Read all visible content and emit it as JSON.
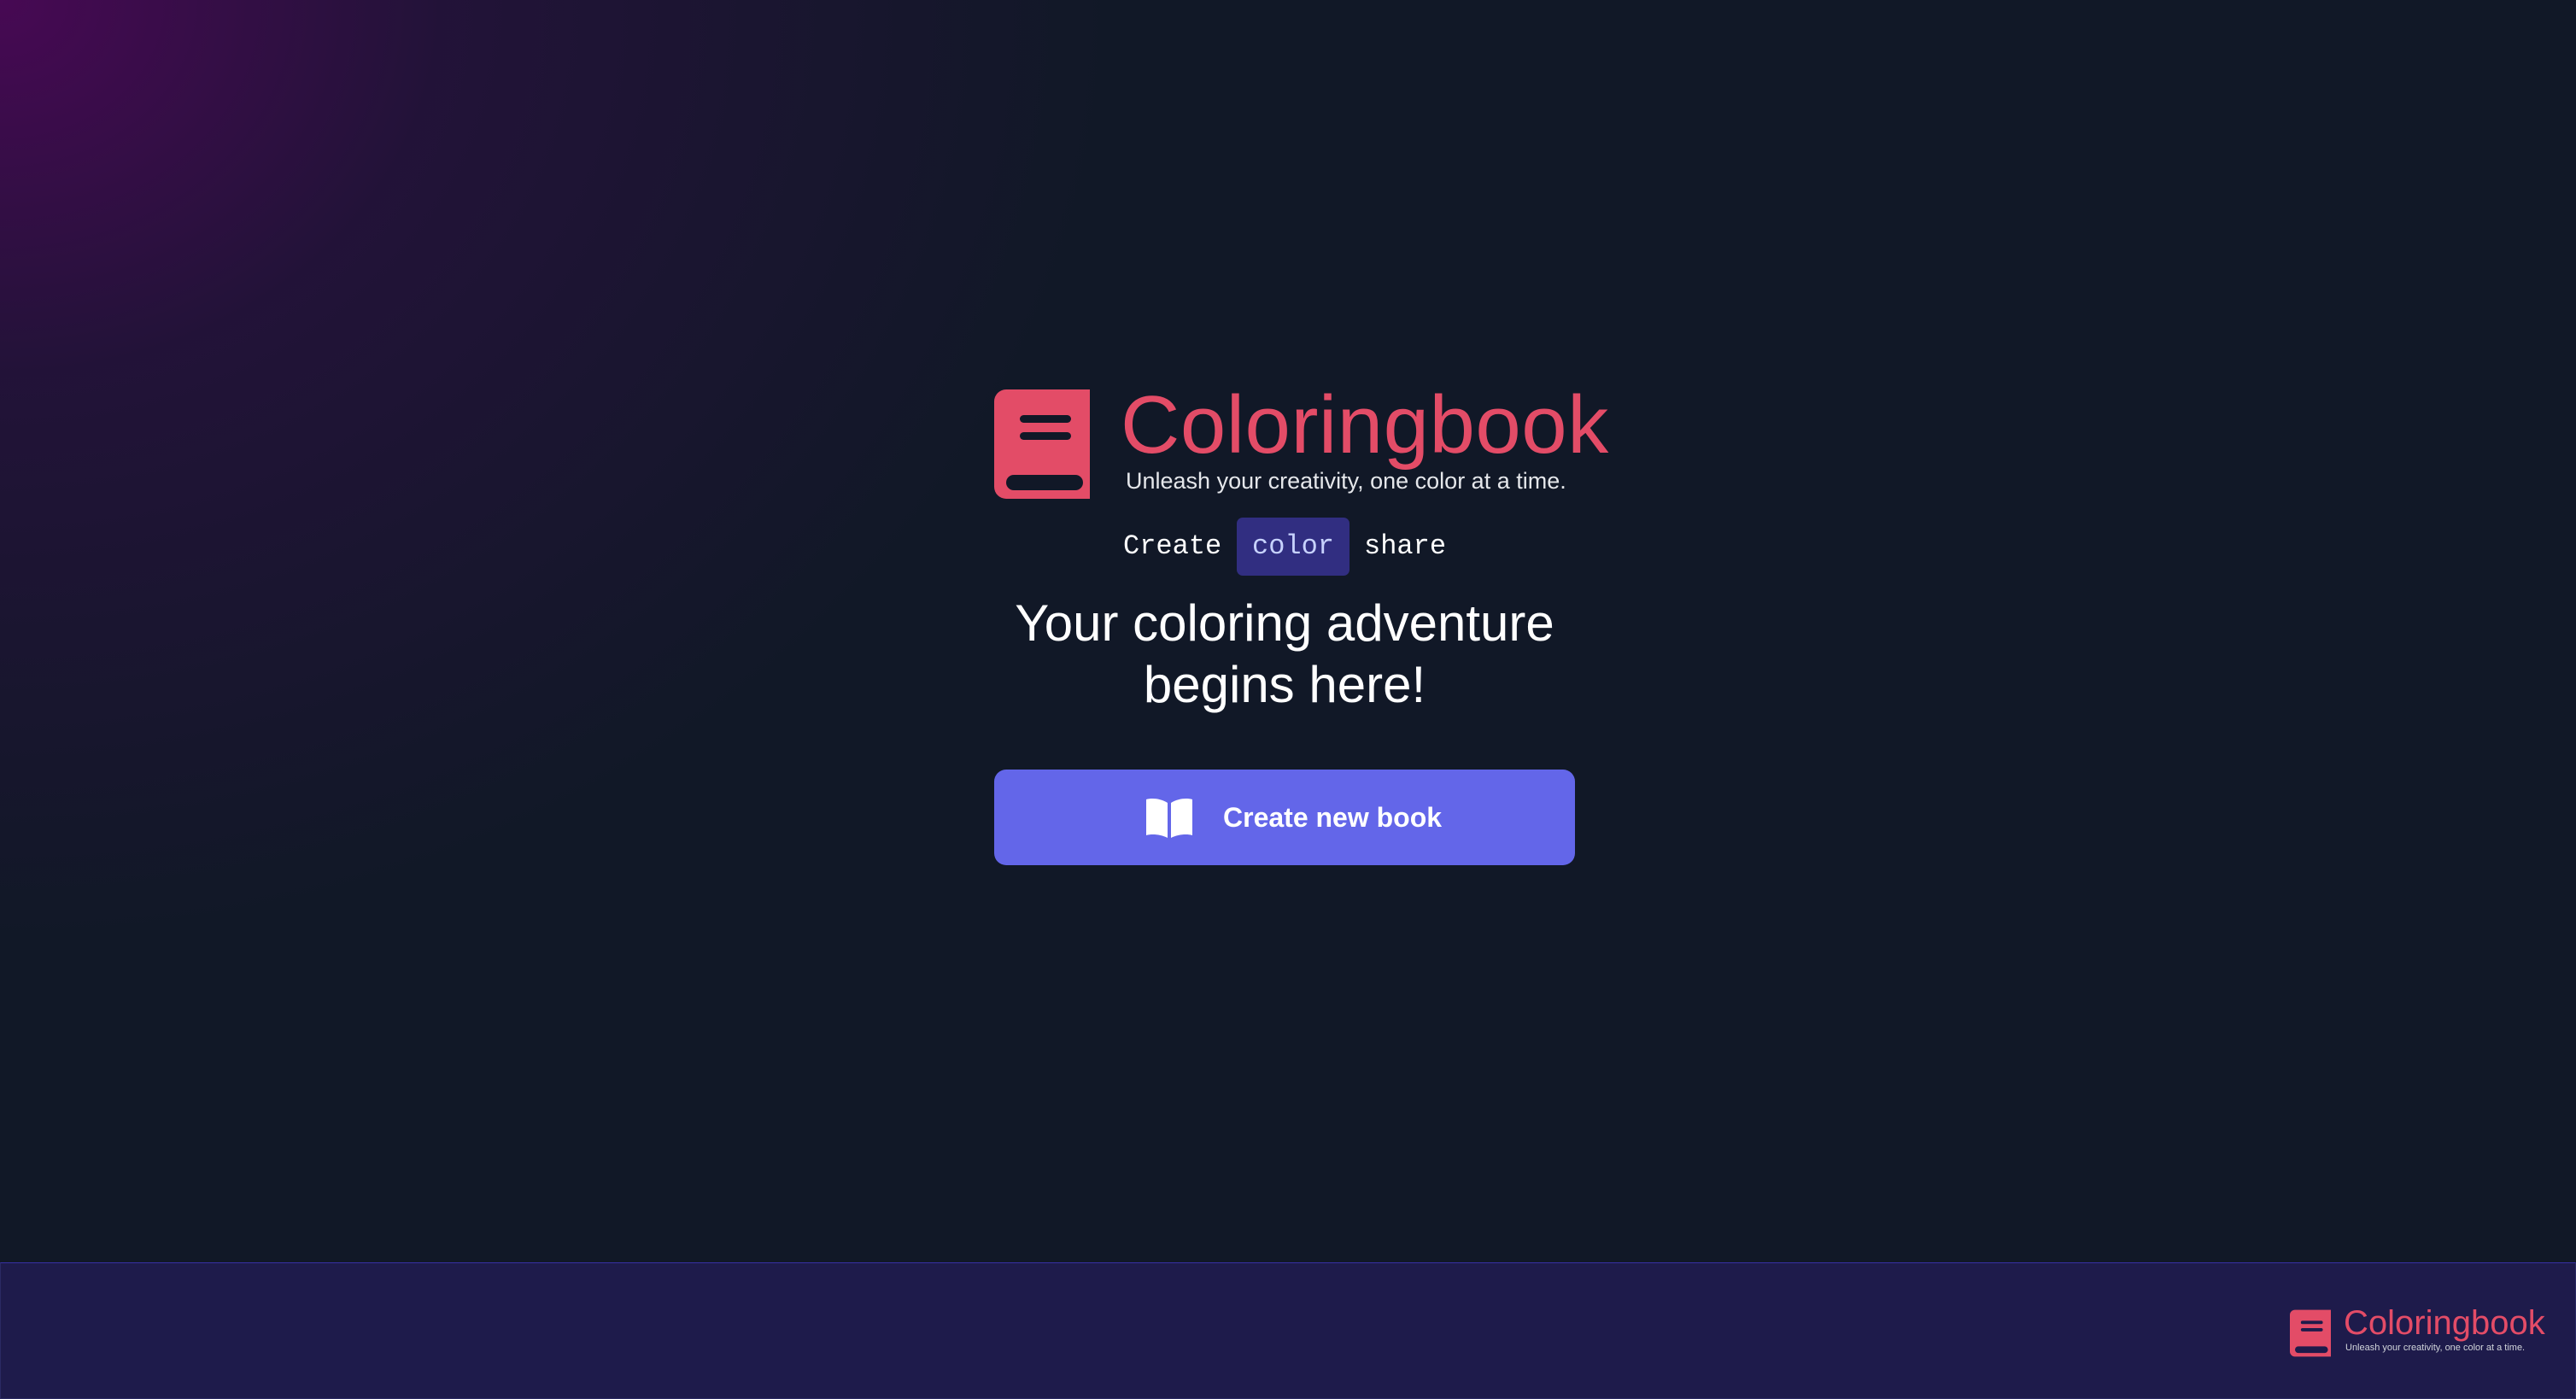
{
  "brand": {
    "name": "Coloringbook",
    "tagline": "Unleash your creativity, one color at a time.",
    "logo_icon": "book-icon",
    "color": "#e34c67"
  },
  "hero": {
    "words": [
      "Create",
      "color",
      "share"
    ],
    "highlighted_word": "color",
    "headline": "Your coloring adventure begins here!"
  },
  "cta": {
    "label": "Create new book",
    "icon": "open-book-icon",
    "color": "#6366e9"
  },
  "footer": {
    "brand_name": "Coloringbook",
    "tagline": "Unleash your creativity, one color at a time.",
    "background": "#1e1b4b"
  }
}
